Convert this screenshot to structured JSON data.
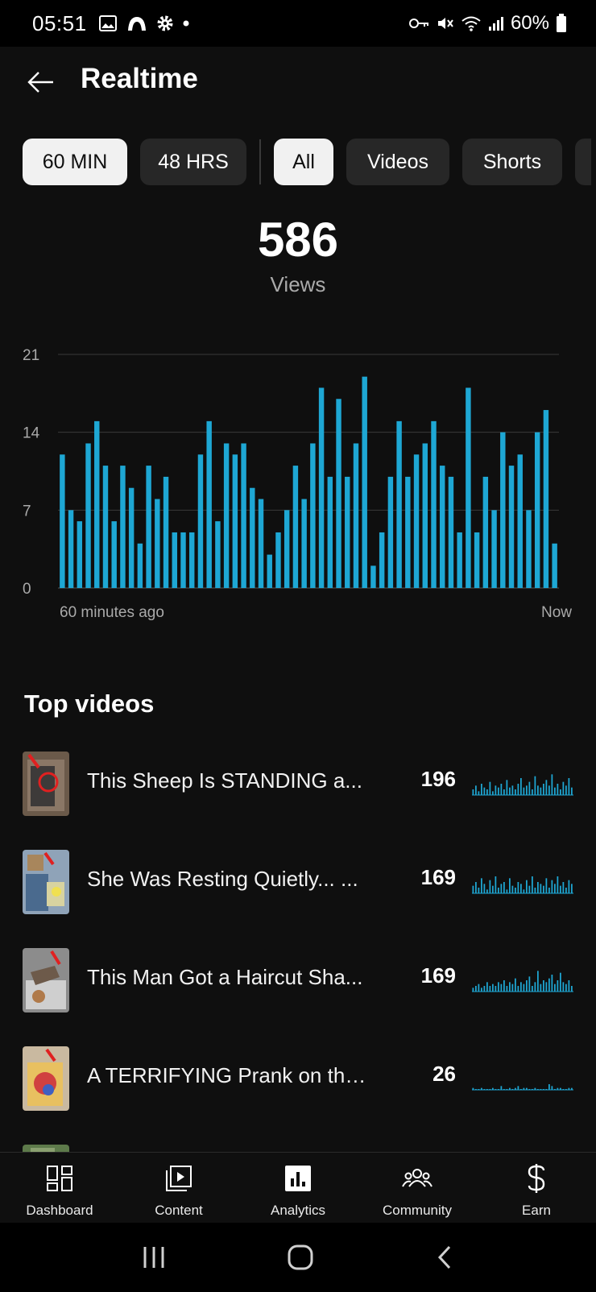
{
  "status_bar": {
    "time": "05:51",
    "battery": "60%",
    "left_icons": [
      "gallery-icon",
      "cloud-icon",
      "settings-gear-icon",
      "dot-icon"
    ],
    "right_icons": [
      "key-icon",
      "mute-icon",
      "wifi-icon",
      "signal-icon",
      "battery-icon"
    ]
  },
  "header": {
    "title": "Realtime"
  },
  "chips": {
    "range": [
      "60 MIN",
      "48 HRS"
    ],
    "filters": [
      "All",
      "Videos",
      "Shorts"
    ]
  },
  "summary": {
    "total_views": "586",
    "label": "Views"
  },
  "chart_data": {
    "type": "bar",
    "title": "",
    "xlabel": "",
    "ylabel": "",
    "ylim": [
      0,
      21
    ],
    "yticks": [
      "0",
      "7",
      "14",
      "21"
    ],
    "x_start_label": "60 minutes ago",
    "x_end_label": "Now",
    "grid": true,
    "color": "#1ea7d4",
    "values": [
      12,
      7,
      6,
      13,
      15,
      11,
      6,
      11,
      9,
      4,
      11,
      8,
      10,
      5,
      5,
      5,
      12,
      15,
      6,
      13,
      12,
      13,
      9,
      8,
      3,
      5,
      7,
      11,
      8,
      13,
      18,
      10,
      17,
      10,
      13,
      19,
      2,
      5,
      10,
      15,
      10,
      12,
      13,
      15,
      11,
      10,
      5,
      18,
      5,
      10,
      7,
      14,
      11,
      12,
      7,
      14,
      16,
      4
    ]
  },
  "top_videos": {
    "title": "Top videos",
    "items": [
      {
        "title": "This Sheep Is STANDING a...",
        "views": "196",
        "spark": [
          3,
          5,
          2,
          6,
          4,
          3,
          7,
          2,
          5,
          4,
          6,
          3,
          8,
          4,
          5,
          3,
          6,
          9,
          4,
          5,
          7,
          3,
          10,
          5,
          4,
          6,
          8,
          5,
          11,
          4,
          6,
          3,
          7,
          5,
          9,
          4
        ]
      },
      {
        "title": "She Was Resting Quietly... ...",
        "views": "169",
        "spark": [
          4,
          6,
          3,
          8,
          5,
          2,
          7,
          4,
          9,
          3,
          5,
          6,
          2,
          8,
          4,
          3,
          6,
          5,
          2,
          7,
          4,
          9,
          3,
          6,
          5,
          4,
          8,
          3,
          7,
          5,
          9,
          4,
          6,
          3,
          7,
          5
        ]
      },
      {
        "title": "This Man Got a Haircut Sha...",
        "views": "169",
        "spark": [
          2,
          3,
          4,
          2,
          3,
          5,
          3,
          4,
          3,
          5,
          4,
          6,
          3,
          5,
          4,
          7,
          3,
          5,
          4,
          6,
          8,
          3,
          5,
          11,
          4,
          6,
          5,
          7,
          9,
          4,
          6,
          10,
          5,
          4,
          6,
          3
        ]
      },
      {
        "title": "A TERRIFYING Prank on the...",
        "views": "26",
        "spark": [
          1,
          0,
          0,
          1,
          0,
          0,
          0,
          1,
          0,
          0,
          2,
          0,
          0,
          1,
          0,
          1,
          2,
          0,
          1,
          1,
          0,
          0,
          1,
          0,
          0,
          0,
          0,
          3,
          2,
          0,
          1,
          1,
          0,
          0,
          1,
          1
        ]
      }
    ]
  },
  "bottom_nav": [
    {
      "label": "Dashboard",
      "icon": "dashboard-icon"
    },
    {
      "label": "Content",
      "icon": "content-icon"
    },
    {
      "label": "Analytics",
      "icon": "analytics-icon"
    },
    {
      "label": "Community",
      "icon": "community-icon"
    },
    {
      "label": "Earn",
      "icon": "dollar-icon"
    }
  ]
}
